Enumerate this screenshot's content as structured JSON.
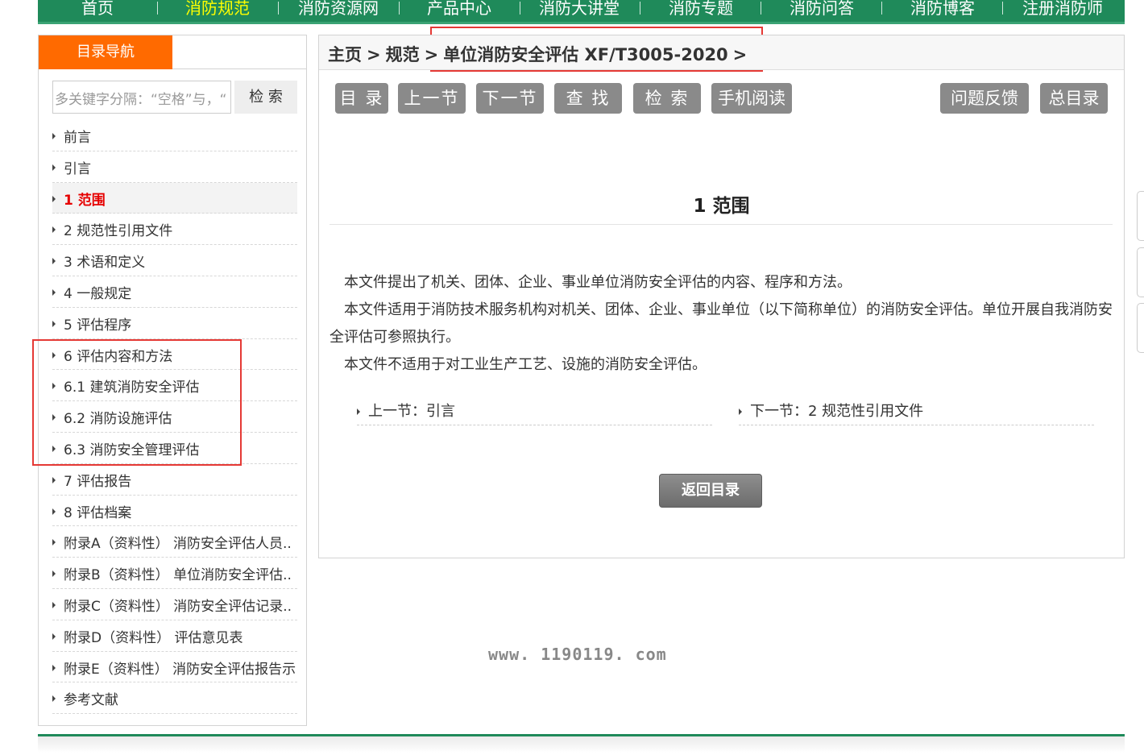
{
  "topnav": {
    "items": [
      {
        "label": "首页",
        "active": false
      },
      {
        "label": "消防规范",
        "active": true
      },
      {
        "label": "消防资源网",
        "active": false
      },
      {
        "label": "产品中心",
        "active": false
      },
      {
        "label": "消防大讲堂",
        "active": false
      },
      {
        "label": "消防专题",
        "active": false
      },
      {
        "label": "消防问答",
        "active": false
      },
      {
        "label": "消防博客",
        "active": false
      },
      {
        "label": "注册消防师",
        "active": false
      }
    ]
  },
  "sidebar": {
    "tab_label": "目录导航",
    "search": {
      "placeholder": "多关键字分隔：“空格”与，“",
      "button_label": "检 索"
    },
    "items": [
      {
        "label": "前言"
      },
      {
        "label": "引言"
      },
      {
        "label": "1 范围",
        "current": true
      },
      {
        "label": "2 规范性引用文件"
      },
      {
        "label": "3 术语和定义"
      },
      {
        "label": "4 一般规定"
      },
      {
        "label": "5 评估程序"
      },
      {
        "label": "6 评估内容和方法"
      },
      {
        "label": "6.1 建筑消防安全评估"
      },
      {
        "label": "6.2 消防设施评估"
      },
      {
        "label": "6.3 消防安全管理评估"
      },
      {
        "label": "7 评估报告"
      },
      {
        "label": "8 评估档案"
      },
      {
        "label": "附录A（资料性） 消防安全评估人员.."
      },
      {
        "label": "附录B（资料性） 单位消防安全评估.."
      },
      {
        "label": "附录C（资料性） 消防安全评估记录.."
      },
      {
        "label": "附录D（资料性） 评估意见表"
      },
      {
        "label": "附录E（资料性） 消防安全评估报告示"
      },
      {
        "label": "参考文献"
      }
    ]
  },
  "breadcrumb": {
    "home": "主页",
    "sep": ">",
    "category": "规范",
    "doc": "单位消防安全评估 XF/T3005-2020"
  },
  "toolbar": {
    "catalog": "目 录",
    "prev": "上一节",
    "next": "下一节",
    "find": "查 找",
    "search": "检 索",
    "mobile": "手机阅读",
    "feedback": "问题反馈",
    "all_catalog": "总目录"
  },
  "content": {
    "title": "1  范围",
    "paragraphs": [
      "　本文件提出了机关、团体、企业、事业单位消防安全评估的内容、程序和方法。",
      "　本文件适用于消防技术服务机构对机关、团体、企业、事业单位（以下简称单位）的消防安全评估。单位开展自我消防安全评估可参照执行。",
      "　本文件不适用于对工业生产工艺、设施的消防安全评估。"
    ],
    "prev_link": "上一节：引言",
    "next_link": "下一节：2 规范性引用文件",
    "back_button": "返回目录"
  },
  "watermark": "www. 1190119. com"
}
